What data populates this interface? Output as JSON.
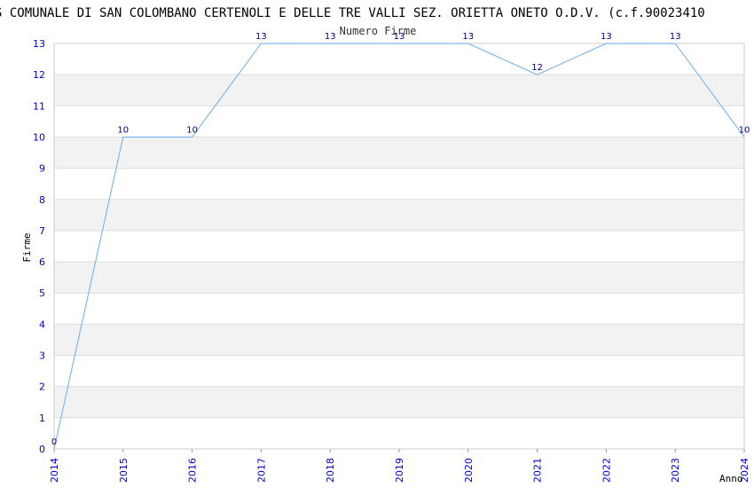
{
  "chart_data": {
    "type": "line",
    "title": "S COMUNALE DI SAN COLOMBANO CERTENOLI E DELLE TRE VALLI SEZ. ORIETTA ONETO O.D.V. (c.f.90023410",
    "subtitle": "Numero Firme",
    "xlabel": "Anno",
    "ylabel": "Firme",
    "x": [
      "2014",
      "2015",
      "2016",
      "2017",
      "2018",
      "2019",
      "2020",
      "2021",
      "2022",
      "2023",
      "2024"
    ],
    "series": [
      {
        "values": [
          0,
          10,
          10,
          13,
          13,
          13,
          13,
          12,
          13,
          13,
          10
        ]
      }
    ],
    "ylim": [
      0,
      13
    ],
    "yticks": [
      "0",
      "1",
      "2",
      "3",
      "4",
      "5",
      "6",
      "7",
      "8",
      "9",
      "10",
      "11",
      "12",
      "13"
    ],
    "grid": true,
    "legend": "none",
    "colors": {
      "line": "#6aaee8",
      "band": "#f2f2f2",
      "tick": "#0000cc",
      "data_label": "#000080"
    }
  }
}
